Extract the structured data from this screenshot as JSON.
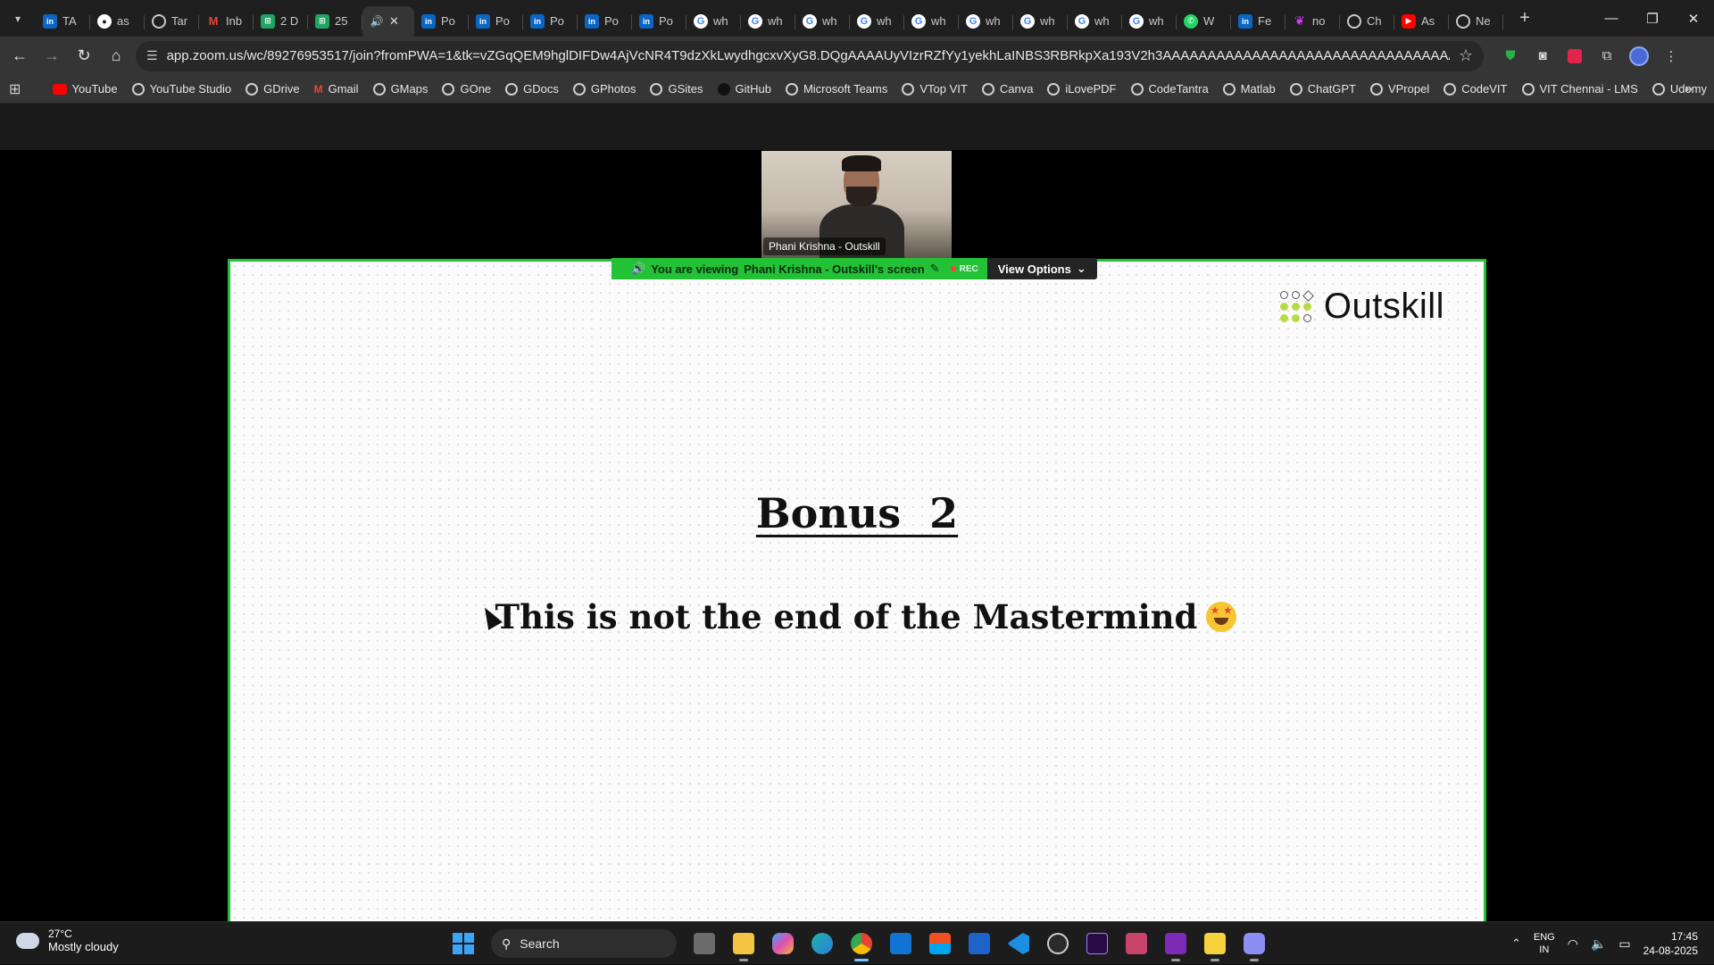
{
  "browser": {
    "tabs": [
      {
        "label": "TA",
        "icon": "linkedin-icon"
      },
      {
        "label": "as",
        "icon": "github-icon"
      },
      {
        "label": "Tar",
        "icon": "globe-icon"
      },
      {
        "label": "Inb",
        "icon": "gmail-icon"
      },
      {
        "label": "2 D",
        "icon": "sheets-icon"
      },
      {
        "label": "25",
        "icon": "sheets-icon"
      },
      {
        "label": "",
        "icon": "speaker-icon",
        "active": true
      },
      {
        "label": "Po",
        "icon": "linkedin-icon"
      },
      {
        "label": "Po",
        "icon": "linkedin-icon"
      },
      {
        "label": "Po",
        "icon": "linkedin-icon"
      },
      {
        "label": "Po",
        "icon": "linkedin-icon"
      },
      {
        "label": "Po",
        "icon": "linkedin-icon"
      },
      {
        "label": "wh",
        "icon": "google-icon"
      },
      {
        "label": "wh",
        "icon": "google-icon"
      },
      {
        "label": "wh",
        "icon": "google-icon"
      },
      {
        "label": "wh",
        "icon": "google-icon"
      },
      {
        "label": "wh",
        "icon": "google-icon"
      },
      {
        "label": "wh",
        "icon": "google-icon"
      },
      {
        "label": "wh",
        "icon": "google-icon"
      },
      {
        "label": "wh",
        "icon": "google-icon"
      },
      {
        "label": "wh",
        "icon": "google-icon"
      },
      {
        "label": "W",
        "icon": "whatsapp-icon"
      },
      {
        "label": "Fe",
        "icon": "linkedin-icon"
      },
      {
        "label": "no",
        "icon": "feather-icon"
      },
      {
        "label": "Ch",
        "icon": "chatgpt-icon"
      },
      {
        "label": "As",
        "icon": "youtube-icon"
      },
      {
        "label": "Ne",
        "icon": "globe-icon"
      }
    ],
    "url": "app.zoom.us/wc/89276953517/join?fromPWA=1&tk=vZGqQEM9hglDIFDw4AjVcNR4T9dzXkLwydhgcxvXyG8.DQgAAAAUyVIzrRZfYy1yekhLaINBS3RBRkpXa193V2h3AAAAAAAAAAAAAAAAAAAAAAAAAAAAAAAAAAAAAAA&_x_zm_r...",
    "bookmarks": [
      "YouTube",
      "YouTube Studio",
      "GDrive",
      "Gmail",
      "GMaps",
      "GOne",
      "GDocs",
      "GPhotos",
      "GSites",
      "GitHub",
      "Microsoft Teams",
      "VTop VIT",
      "Canva",
      "iLovePDF",
      "CodeTantra",
      "Matlab",
      "ChatGPT",
      "VPropel",
      "CodeVIT",
      "VIT Chennai - LMS",
      "Udemy"
    ]
  },
  "zoom": {
    "participant_name": "Phani Krishna - Outskill",
    "viewing_prefix": "You are viewing",
    "viewing_name": "Phani Krishna - Outskill's screen",
    "rec_label": "REC",
    "view_options_label": "View Options",
    "accent_color": "#23c136"
  },
  "slide": {
    "logo_text": "Outskill",
    "title": "Bonus  2",
    "subtitle": "This is not the end of the Mastermind"
  },
  "taskbar": {
    "temperature": "27°C",
    "weather": "Mostly cloudy",
    "search_label": "Search",
    "lang_top": "ENG",
    "lang_bottom": "IN",
    "time": "17:45",
    "date": "24-08-2025"
  }
}
